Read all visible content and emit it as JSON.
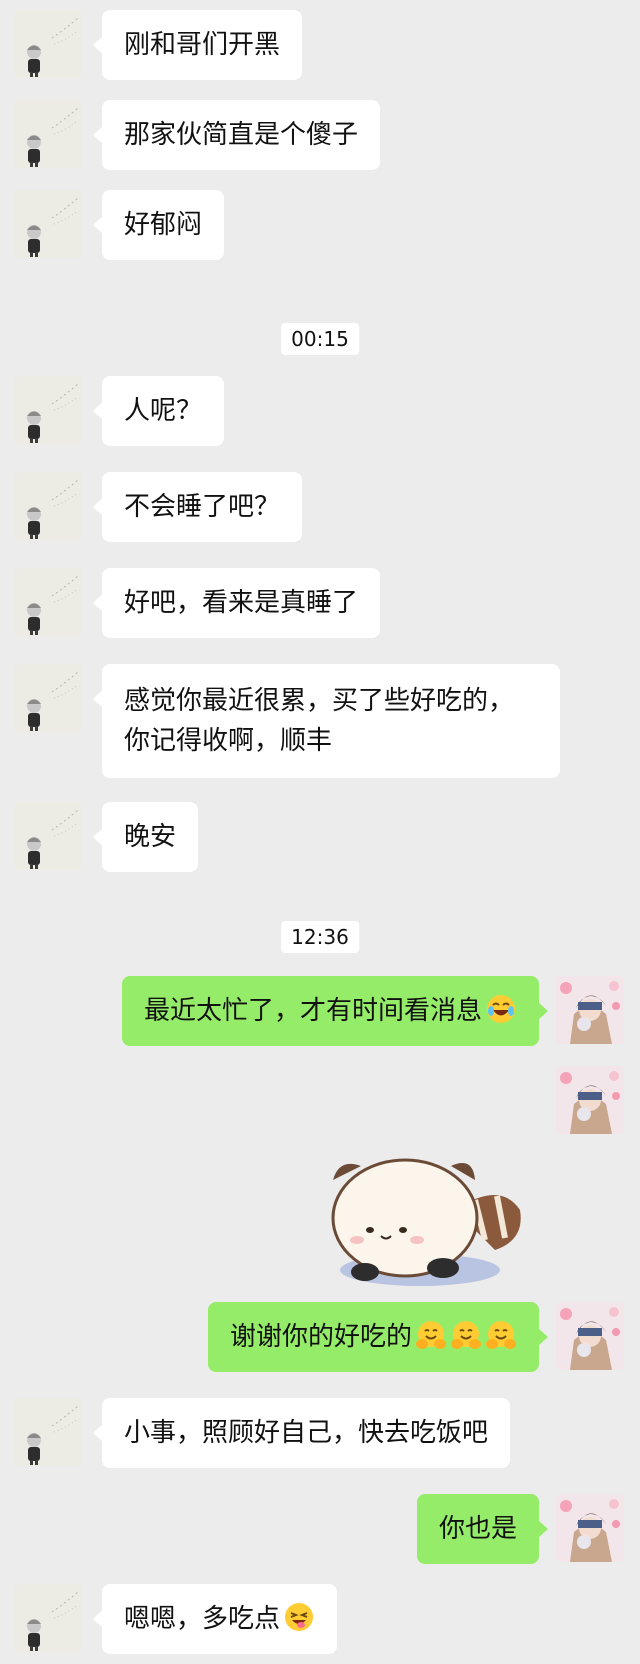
{
  "messages": [
    {
      "text": "刚和哥们开黑"
    },
    {
      "text": "那家伙简直是个傻子"
    },
    {
      "text": "好郁闷"
    },
    {
      "time": "00:15"
    },
    {
      "text": "人呢？"
    },
    {
      "text": "不会睡了吧？"
    },
    {
      "text": "好吧，看来是真睡了"
    },
    {
      "line1": "感觉你最近很累，买了些好吃的，",
      "line2": "你记得收啊，顺丰"
    },
    {
      "text": "晚安"
    },
    {
      "time": "12:36"
    },
    {
      "text": "最近太忙了，才有时间看消息",
      "emoji": "rofl-emoji"
    },
    {
      "sticker": "raccoon-cat-lying-sticker"
    },
    {
      "text": "谢谢你的好吃的",
      "emoji": "hugging-face-emoji"
    },
    {
      "text": "小事，照顾好自己，快去吃饭吧"
    },
    {
      "text": "你也是"
    },
    {
      "text": "嗯嗯，多吃点",
      "emoji": "wink-tongue-emoji"
    }
  ],
  "colors": {
    "background": "#ececec",
    "incoming_bubble": "#ffffff",
    "outgoing_bubble": "#95ec69"
  }
}
